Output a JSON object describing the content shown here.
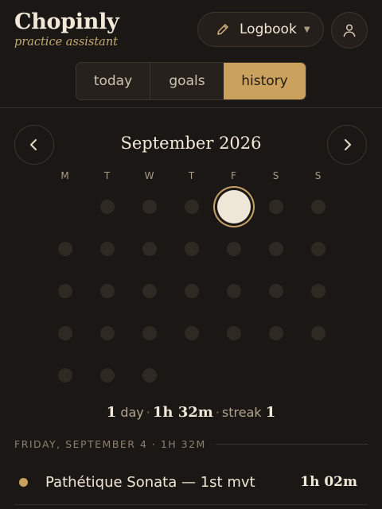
{
  "app": {
    "title": "Chopinly",
    "subtitle": "practice assistant"
  },
  "header": {
    "logbook_label": "Logbook",
    "logbook_icon": "pencil-icon",
    "profile_icon": "user-icon"
  },
  "tabs": [
    {
      "label": "today",
      "active": false
    },
    {
      "label": "goals",
      "active": false
    },
    {
      "label": "history",
      "active": true
    }
  ],
  "calendar": {
    "month_label": "September 2026",
    "weekdays": [
      "M",
      "T",
      "W",
      "T",
      "F",
      "S",
      "S"
    ],
    "first_weekday_index": 1,
    "days_in_month": 30,
    "active_days": [
      4
    ]
  },
  "summary": {
    "days": "1",
    "days_label": "day",
    "duration": "1h 32m",
    "streak_label": "streak",
    "streak": "1"
  },
  "day_section": {
    "heading": "FRIDAY, SEPTEMBER 4 · 1H 32M",
    "sessions": [
      {
        "piece": "Pathétique Sonata — 1st mvt",
        "duration": "1h 02m"
      }
    ]
  },
  "colors": {
    "accent": "#caa25e",
    "background": "#1b1714"
  }
}
